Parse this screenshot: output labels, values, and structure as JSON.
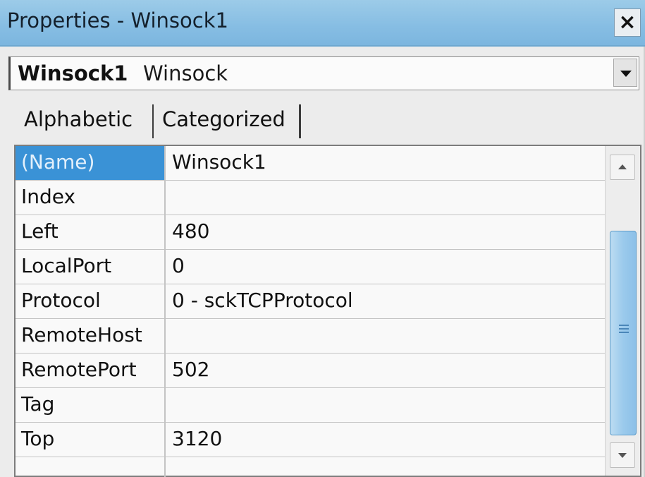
{
  "window": {
    "title": "Properties - Winsock1",
    "close_icon": "close-icon",
    "close_label": "×"
  },
  "object_selector": {
    "name": "Winsock1",
    "type": "Winsock",
    "dropdown_icon": "chevron-down-icon"
  },
  "tabs": [
    {
      "label": "Alphabetic",
      "active": true
    },
    {
      "label": "Categorized",
      "active": false
    }
  ],
  "properties": [
    {
      "name": "(Name)",
      "value": "Winsock1",
      "selected": true
    },
    {
      "name": "Index",
      "value": ""
    },
    {
      "name": "Left",
      "value": "480"
    },
    {
      "name": "LocalPort",
      "value": "0"
    },
    {
      "name": "Protocol",
      "value": "0 - sckTCPProtocol"
    },
    {
      "name": "RemoteHost",
      "value": ""
    },
    {
      "name": "RemotePort",
      "value": "502"
    },
    {
      "name": "Tag",
      "value": ""
    },
    {
      "name": "Top",
      "value": "3120"
    }
  ],
  "colors": {
    "titlebar": "#86bde3",
    "selection": "#3a92d6",
    "scroll_thumb": "#9bcaec"
  }
}
